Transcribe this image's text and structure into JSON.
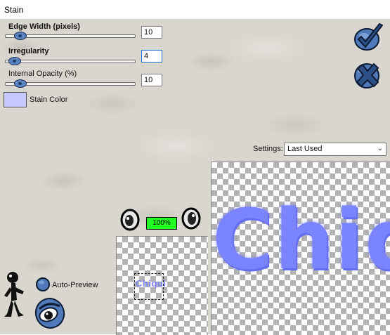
{
  "window": {
    "title": "Stain"
  },
  "controls": {
    "edge_width": {
      "label": "Edge Width (pixels)",
      "value": "10",
      "slider_fraction": 0.08
    },
    "irregularity": {
      "label": "Irregularity",
      "value": "4",
      "slider_fraction": 0.03
    },
    "internal_opacity": {
      "label": "Internal Opacity (%)",
      "value": "10",
      "slider_fraction": 0.08
    },
    "stain_color": {
      "label": "Stain Color",
      "color": "#c6c8ff"
    }
  },
  "settings": {
    "label": "Settings:",
    "selected": "Last Used"
  },
  "preview": {
    "zoom": "100%",
    "small_text": "Chiqui",
    "large_text": "Chiqui",
    "text_color": "#7b84ff"
  },
  "auto_preview": {
    "label": "Auto-Preview",
    "icon": "eye-icon"
  },
  "buttons": {
    "ok": {
      "icon": "checkmark-icon"
    },
    "cancel": {
      "icon": "x-icon"
    },
    "zoom_in": {
      "icon": "zoom-in-eye-icon"
    },
    "zoom_out": {
      "icon": "zoom-out-eye-icon"
    },
    "help": {
      "icon": "help-figure-icon"
    }
  }
}
